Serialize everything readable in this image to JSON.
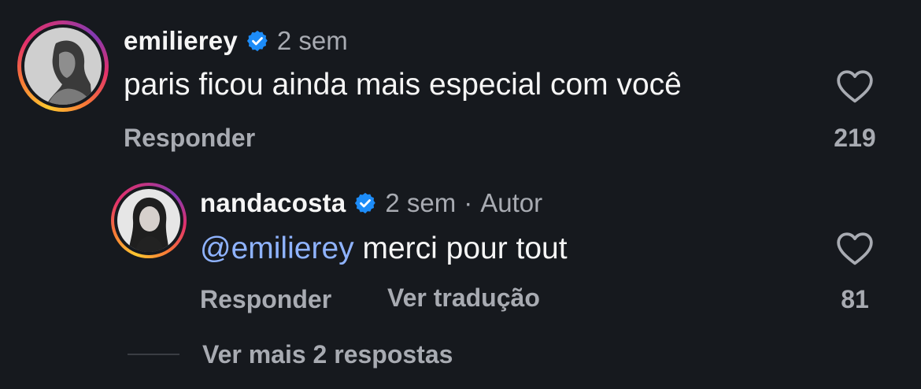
{
  "comment": {
    "username": "emilierey",
    "verified": true,
    "time": "2 sem",
    "text": "paris ficou ainda mais especial com você",
    "reply_label": "Responder",
    "likes": "219"
  },
  "reply": {
    "username": "nandacosta",
    "verified": true,
    "time": "2 sem",
    "separator": "·",
    "author_tag": "Autor",
    "mention": "@emilierey",
    "text": " merci pour tout",
    "reply_label": "Responder",
    "translate_label": "Ver tradução",
    "likes": "81"
  },
  "more_replies_label": "Ver mais 2 respostas",
  "colors": {
    "background": "#16191e",
    "verified_badge": "#1d8cf8",
    "mention": "#8fb3ff",
    "secondary_text": "#a8abb2"
  }
}
